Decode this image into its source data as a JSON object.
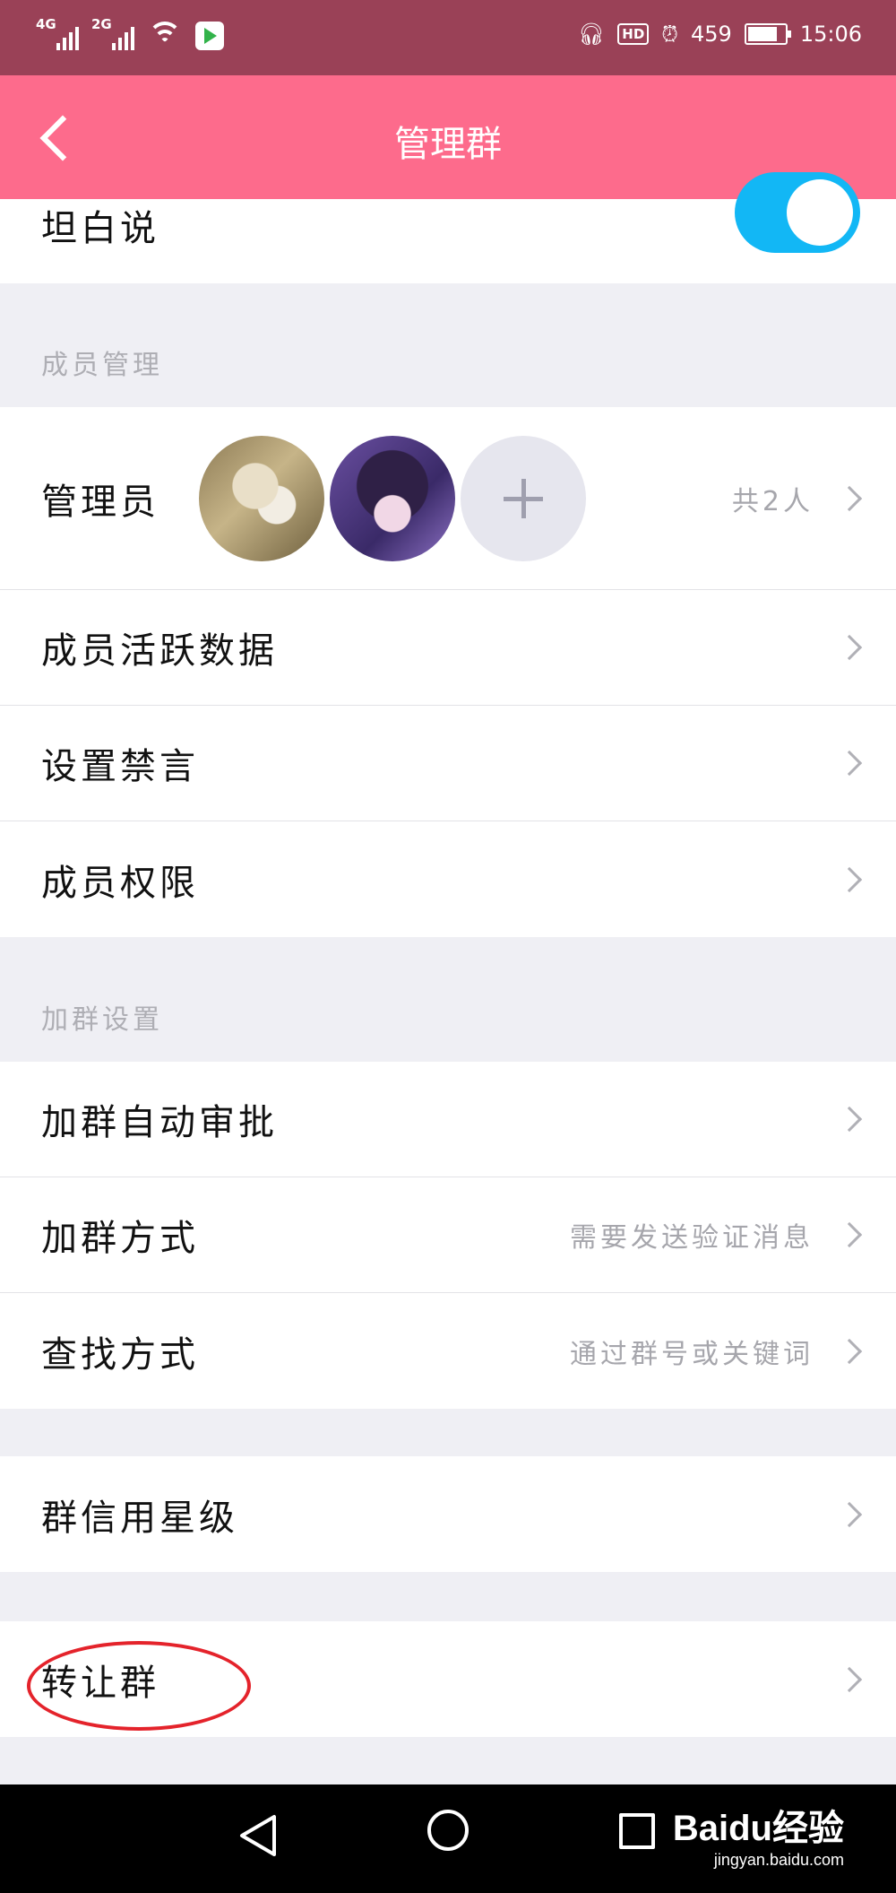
{
  "status_bar": {
    "net1": "4G",
    "net2": "2G",
    "data_speed": "459",
    "hd": "HD",
    "time": "15:06"
  },
  "header": {
    "title": "管理群"
  },
  "top_row": {
    "label": "坦白说",
    "toggle_on": true
  },
  "member_mgmt": {
    "header": "成员管理",
    "admins_label": "管理员",
    "admins_count": "共2人",
    "rows": [
      {
        "label": "成员活跃数据"
      },
      {
        "label": "设置禁言"
      },
      {
        "label": "成员权限"
      }
    ]
  },
  "join_settings": {
    "header": "加群设置",
    "rows": [
      {
        "label": "加群自动审批",
        "value": ""
      },
      {
        "label": "加群方式",
        "value": "需要发送验证消息"
      },
      {
        "label": "查找方式",
        "value": "通过群号或关键词"
      }
    ]
  },
  "credit": {
    "label": "群信用星级"
  },
  "transfer": {
    "label": "转让群"
  },
  "watermark": {
    "brand": "Baidu经验",
    "url": "jingyan.baidu.com"
  },
  "icons": [
    "back-icon",
    "chevron-right-icon",
    "plus-icon",
    "nav-back-icon",
    "nav-home-icon",
    "nav-recent-icon",
    "headphones-icon",
    "alarm-icon",
    "battery-icon",
    "wifi-icon"
  ],
  "colors": {
    "status_bar": "#9a4157",
    "title_bar": "#fd6b8c",
    "toggle": "#12b7f5",
    "annotation": "#e4232b"
  }
}
